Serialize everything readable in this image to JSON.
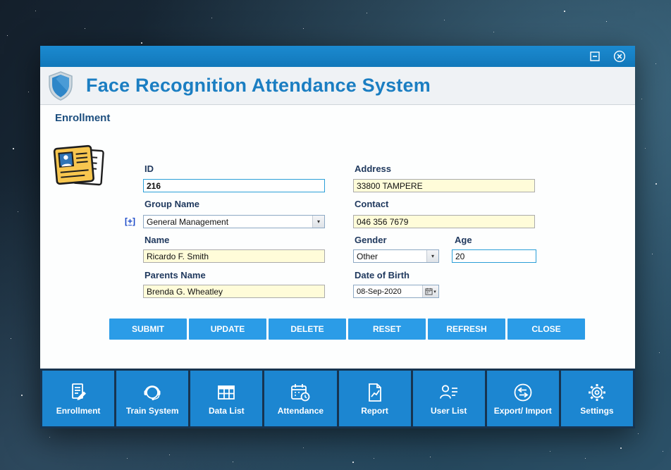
{
  "header": {
    "title": "Face Recognition Attendance System"
  },
  "section": {
    "title": "Enrollment"
  },
  "form": {
    "fields": {
      "id": {
        "label": "ID",
        "value": "216"
      },
      "address": {
        "label": "Address",
        "value": "33800 TAMPERE"
      },
      "group_name": {
        "label": "Group Name",
        "value": "General Management",
        "add_label": "[+]"
      },
      "contact": {
        "label": "Contact",
        "value": "046 356 7679"
      },
      "name": {
        "label": "Name",
        "value": "Ricardo F. Smith"
      },
      "gender": {
        "label": "Gender",
        "value": "Other"
      },
      "age": {
        "label": "Age",
        "value": "20"
      },
      "parents_name": {
        "label": "Parents Name",
        "value": "Brenda G. Wheatley"
      },
      "dob": {
        "label": "Date of Birth",
        "value": "08-Sep-2020"
      }
    },
    "buttons": [
      {
        "label": "SUBMIT"
      },
      {
        "label": "UPDATE"
      },
      {
        "label": "DELETE"
      },
      {
        "label": "RESET"
      },
      {
        "label": "REFRESH"
      },
      {
        "label": "CLOSE"
      }
    ]
  },
  "nav": {
    "items": [
      {
        "label": "Enrollment",
        "icon": "enrollment-icon"
      },
      {
        "label": "Train System",
        "icon": "train-system-icon"
      },
      {
        "label": "Data List",
        "icon": "data-list-icon"
      },
      {
        "label": "Attendance",
        "icon": "attendance-icon"
      },
      {
        "label": "Report",
        "icon": "report-icon"
      },
      {
        "label": "User List",
        "icon": "user-list-icon"
      },
      {
        "label": "Export/ Import",
        "icon": "export-import-icon"
      },
      {
        "label": "Settings",
        "icon": "settings-icon"
      }
    ]
  },
  "colors": {
    "titlebar": "#1583c9",
    "accent": "#1b7ec2",
    "button": "#2b9ce7",
    "nav_background": "#173450",
    "nav_tile": "#1c86d1",
    "input_yellow": "#fffcd9",
    "input_blue_border": "#2b9fd8"
  }
}
